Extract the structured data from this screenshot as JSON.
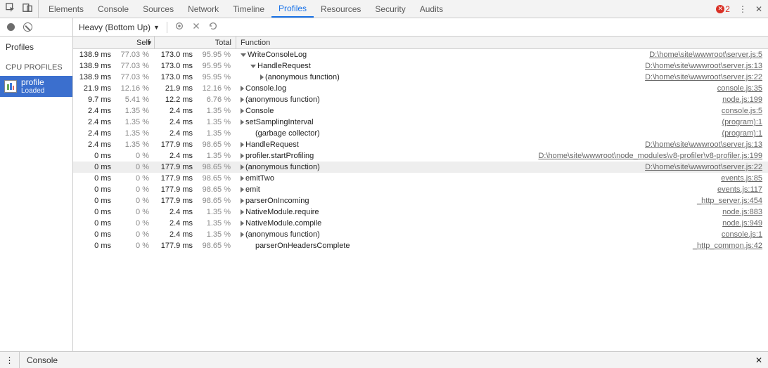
{
  "tabs": [
    "Elements",
    "Console",
    "Sources",
    "Network",
    "Timeline",
    "Profiles",
    "Resources",
    "Security",
    "Audits"
  ],
  "active_tab": "Profiles",
  "errors": {
    "count": "2"
  },
  "toolbar": {
    "view_label": "Heavy (Bottom Up)"
  },
  "sidebar": {
    "heading": "Profiles",
    "group": "CPU PROFILES",
    "items": [
      {
        "name": "profile",
        "status": "Loaded",
        "selected": true
      }
    ]
  },
  "columns": {
    "self": "Self",
    "total": "Total",
    "function": "Function"
  },
  "rows": [
    {
      "self_ms": "138.9 ms",
      "self_pct": "77.03 %",
      "total_ms": "173.0 ms",
      "total_pct": "95.95 %",
      "indent": 0,
      "arrow": "down",
      "name": "WriteConsoleLog",
      "src": "D:\\home\\site\\wwwroot\\server.js:5"
    },
    {
      "self_ms": "138.9 ms",
      "self_pct": "77.03 %",
      "total_ms": "173.0 ms",
      "total_pct": "95.95 %",
      "indent": 1,
      "arrow": "down",
      "name": "HandleRequest",
      "src": "D:\\home\\site\\wwwroot\\server.js:13"
    },
    {
      "self_ms": "138.9 ms",
      "self_pct": "77.03 %",
      "total_ms": "173.0 ms",
      "total_pct": "95.95 %",
      "indent": 2,
      "arrow": "right",
      "name": "(anonymous function)",
      "src": "D:\\home\\site\\wwwroot\\server.js:22"
    },
    {
      "self_ms": "21.9 ms",
      "self_pct": "12.16 %",
      "total_ms": "21.9 ms",
      "total_pct": "12.16 %",
      "indent": 0,
      "arrow": "right",
      "name": "Console.log",
      "src": "console.js:35"
    },
    {
      "self_ms": "9.7 ms",
      "self_pct": "5.41 %",
      "total_ms": "12.2 ms",
      "total_pct": "6.76 %",
      "indent": 0,
      "arrow": "right",
      "name": "(anonymous function)",
      "src": "node.js:199"
    },
    {
      "self_ms": "2.4 ms",
      "self_pct": "1.35 %",
      "total_ms": "2.4 ms",
      "total_pct": "1.35 %",
      "indent": 0,
      "arrow": "right",
      "name": "Console",
      "src": "console.js:5"
    },
    {
      "self_ms": "2.4 ms",
      "self_pct": "1.35 %",
      "total_ms": "2.4 ms",
      "total_pct": "1.35 %",
      "indent": 0,
      "arrow": "right",
      "name": "setSamplingInterval",
      "src": "(program):1"
    },
    {
      "self_ms": "2.4 ms",
      "self_pct": "1.35 %",
      "total_ms": "2.4 ms",
      "total_pct": "1.35 %",
      "indent": 1,
      "arrow": "none",
      "name": "(garbage collector)",
      "src": "(program):1"
    },
    {
      "self_ms": "2.4 ms",
      "self_pct": "1.35 %",
      "total_ms": "177.9 ms",
      "total_pct": "98.65 %",
      "indent": 0,
      "arrow": "right",
      "name": "HandleRequest",
      "src": "D:\\home\\site\\wwwroot\\server.js:13"
    },
    {
      "self_ms": "0 ms",
      "self_pct": "0 %",
      "total_ms": "2.4 ms",
      "total_pct": "1.35 %",
      "indent": 0,
      "arrow": "right",
      "name": "profiler.startProfiling",
      "src": "D:\\home\\site\\wwwroot\\node_modules\\v8-profiler\\v8-profiler.js:199"
    },
    {
      "self_ms": "0 ms",
      "self_pct": "0 %",
      "total_ms": "177.9 ms",
      "total_pct": "98.65 %",
      "indent": 0,
      "arrow": "right",
      "name": "(anonymous function)",
      "src": "D:\\home\\site\\wwwroot\\server.js:22",
      "hl": true
    },
    {
      "self_ms": "0 ms",
      "self_pct": "0 %",
      "total_ms": "177.9 ms",
      "total_pct": "98.65 %",
      "indent": 0,
      "arrow": "right",
      "name": "emitTwo",
      "src": "events.js:85"
    },
    {
      "self_ms": "0 ms",
      "self_pct": "0 %",
      "total_ms": "177.9 ms",
      "total_pct": "98.65 %",
      "indent": 0,
      "arrow": "right",
      "name": "emit",
      "src": "events.js:117"
    },
    {
      "self_ms": "0 ms",
      "self_pct": "0 %",
      "total_ms": "177.9 ms",
      "total_pct": "98.65 %",
      "indent": 0,
      "arrow": "right",
      "name": "parserOnIncoming",
      "src": "_http_server.js:454"
    },
    {
      "self_ms": "0 ms",
      "self_pct": "0 %",
      "total_ms": "2.4 ms",
      "total_pct": "1.35 %",
      "indent": 0,
      "arrow": "right",
      "name": "NativeModule.require",
      "src": "node.js:883"
    },
    {
      "self_ms": "0 ms",
      "self_pct": "0 %",
      "total_ms": "2.4 ms",
      "total_pct": "1.35 %",
      "indent": 0,
      "arrow": "right",
      "name": "NativeModule.compile",
      "src": "node.js:949"
    },
    {
      "self_ms": "0 ms",
      "self_pct": "0 %",
      "total_ms": "2.4 ms",
      "total_pct": "1.35 %",
      "indent": 0,
      "arrow": "right",
      "name": "(anonymous function)",
      "src": "console.js:1"
    },
    {
      "self_ms": "0 ms",
      "self_pct": "0 %",
      "total_ms": "177.9 ms",
      "total_pct": "98.65 %",
      "indent": 1,
      "arrow": "none",
      "name": "parserOnHeadersComplete",
      "src": "_http_common.js:42"
    }
  ],
  "drawer": {
    "tab": "Console"
  }
}
